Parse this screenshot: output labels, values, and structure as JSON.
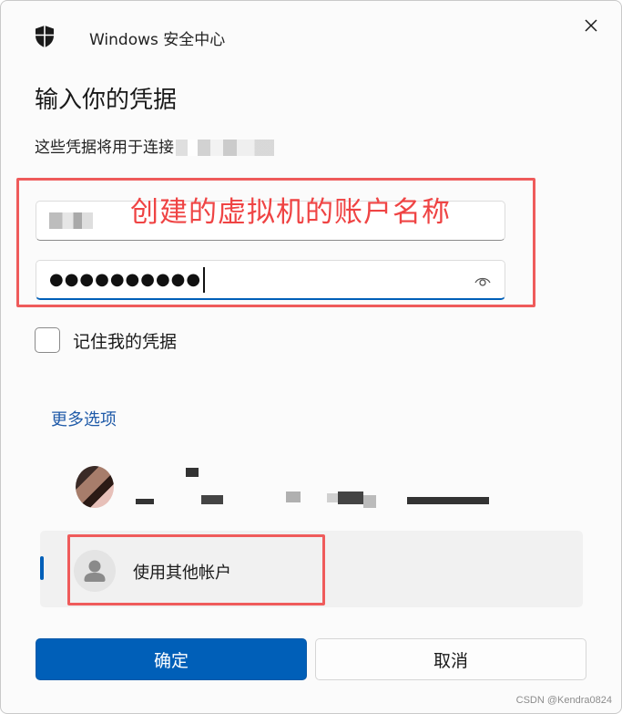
{
  "window": {
    "title": "Windows 安全中心",
    "close_label": "✕"
  },
  "header": {
    "heading": "输入你的凭据",
    "subtext": "这些凭据将用于连接"
  },
  "form": {
    "username_value": "",
    "password_dots": "●●●●●●●●●●",
    "annotation": "创建的虚拟机的账户名称"
  },
  "remember": {
    "label": "记住我的凭据",
    "checked": false
  },
  "more_options": "更多选项",
  "accounts": [
    {
      "label": "",
      "selected": false
    },
    {
      "label": "使用其他帐户",
      "selected": true
    }
  ],
  "buttons": {
    "ok": "确定",
    "cancel": "取消"
  },
  "watermark": "CSDN @Kendra0824",
  "colors": {
    "accent": "#005fb8",
    "annotation_red": "#ef4444",
    "link": "#1f5aa8"
  },
  "icons": {
    "title": "shield-icon",
    "close": "close-icon",
    "reveal": "eye-icon",
    "avatar": "person-icon"
  }
}
